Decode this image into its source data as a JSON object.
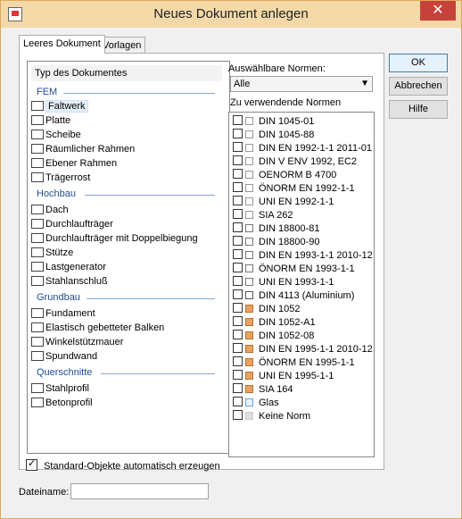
{
  "window": {
    "title": "Neues Dokument anlegen",
    "close_glyph": "✕"
  },
  "tabs": [
    {
      "label": "Leeres Dokument",
      "active": true
    },
    {
      "label": "Vorlagen",
      "active": false
    }
  ],
  "left": {
    "header": "Typ des Dokumentes",
    "groups": [
      {
        "name": "FEM",
        "items": [
          "Faltwerk",
          "Platte",
          "Scheibe",
          "Räumlicher Rahmen",
          "Ebener Rahmen",
          "Trägerrost"
        ],
        "selected": "Faltwerk"
      },
      {
        "name": "Hochbau",
        "items": [
          "Dach",
          "Durchlaufträger",
          "Durchlaufträger mit Doppelbiegung",
          "Stütze",
          "Lastgenerator",
          "Stahlanschluß"
        ]
      },
      {
        "name": "Grundbau",
        "items": [
          "Fundament",
          "Elastisch gebetteter Balken",
          "Winkelstützmauer",
          "Spundwand"
        ]
      },
      {
        "name": "Querschnitte",
        "items": [
          "Stahlprofil",
          "Betonprofil"
        ]
      }
    ]
  },
  "norms": {
    "label": "Auswählbare Normen:",
    "filter_value": "Alle",
    "list_label": "Zu verwendende Normen",
    "items": [
      {
        "label": "DIN 1045-01",
        "icon": "concrete-icon"
      },
      {
        "label": "DIN 1045-88",
        "icon": "concrete-icon"
      },
      {
        "label": "DIN EN 1992-1-1 2011-01",
        "icon": "concrete-icon"
      },
      {
        "label": "DIN V ENV 1992, EC2",
        "icon": "concrete-icon"
      },
      {
        "label": "OENORM B 4700",
        "icon": "concrete-icon"
      },
      {
        "label": "ÖNORM EN 1992-1-1",
        "icon": "concrete-icon"
      },
      {
        "label": "UNI EN 1992-1-1",
        "icon": "concrete-icon"
      },
      {
        "label": "SIA 262",
        "icon": "concrete-icon"
      },
      {
        "label": "DIN 18800-81",
        "icon": "steel-icon"
      },
      {
        "label": "DIN 18800-90",
        "icon": "steel-icon"
      },
      {
        "label": "DIN EN 1993-1-1 2010-12",
        "icon": "steel-icon"
      },
      {
        "label": "ÖNORM EN 1993-1-1",
        "icon": "steel-icon"
      },
      {
        "label": "UNI EN 1993-1-1",
        "icon": "steel-icon"
      },
      {
        "label": "DIN 4113 (Aluminium)",
        "icon": "aluminium-icon"
      },
      {
        "label": "DIN 1052",
        "icon": "wood-icon"
      },
      {
        "label": "DIN 1052-A1",
        "icon": "wood-icon"
      },
      {
        "label": "DIN 1052-08",
        "icon": "wood-icon"
      },
      {
        "label": "DIN EN 1995-1-1 2010-12",
        "icon": "wood-icon"
      },
      {
        "label": "ÖNORM EN 1995-1-1",
        "icon": "wood-icon"
      },
      {
        "label": "UNI EN 1995-1-1",
        "icon": "wood-icon"
      },
      {
        "label": "SIA 164",
        "icon": "wood-icon"
      },
      {
        "label": "Glas",
        "icon": "glass-icon"
      },
      {
        "label": "Keine Norm",
        "icon": "none-icon"
      }
    ]
  },
  "buttons": {
    "ok": "OK",
    "cancel": "Abbrechen",
    "help": "Hilfe"
  },
  "options": {
    "standard_objects_label": "Standard-Objekte automatisch erzeugen",
    "standard_objects_checked": true
  },
  "filename": {
    "label": "Dateiname:",
    "value": ""
  },
  "colors": {
    "titlebar": "#f4d9a8",
    "close": "#c7413b",
    "group_text": "#1e4f91"
  }
}
